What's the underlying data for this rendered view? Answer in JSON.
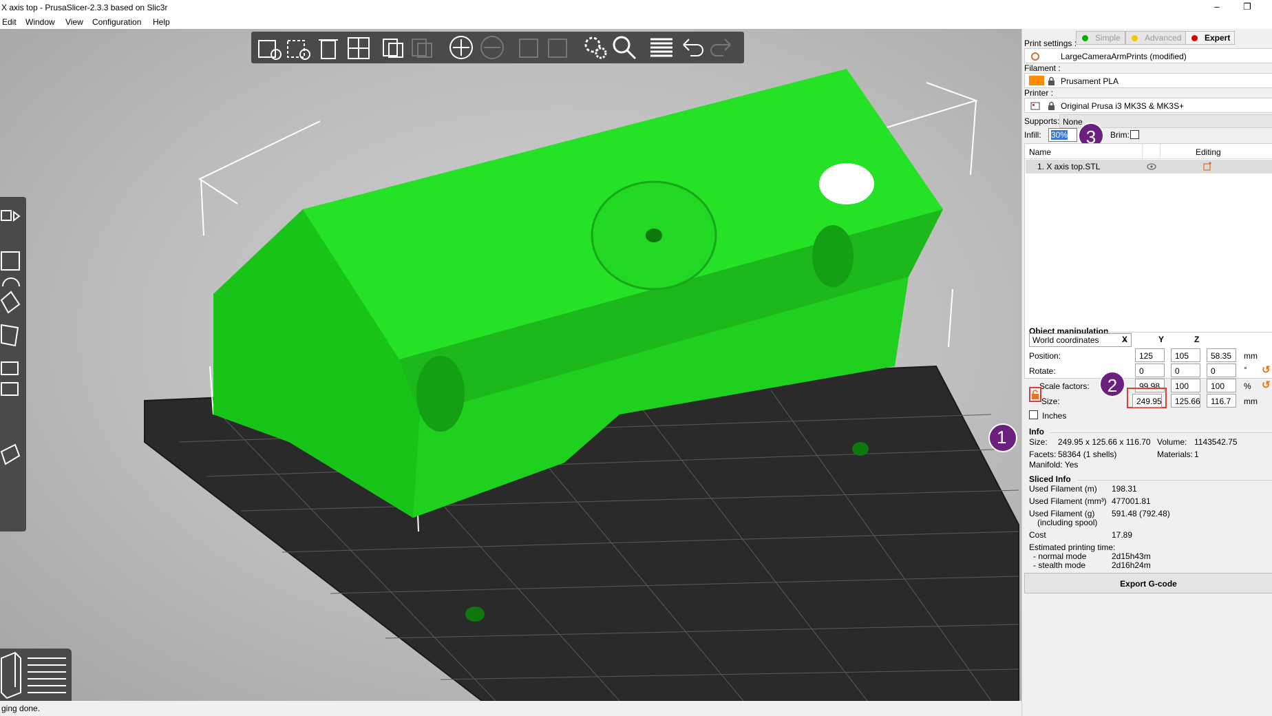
{
  "window": {
    "title": "X axis top - PrusaSlicer-2.3.3 based on Slic3r",
    "minimize": "–",
    "maximize": "❐"
  },
  "menu": [
    "Edit",
    "Window",
    "View",
    "Configuration",
    "Help"
  ],
  "toolbar_icons": [
    "add-icon",
    "delete-icon",
    "delete-all-icon",
    "arrange-icon",
    "copy-icon",
    "paste-icon",
    "add-instance-icon",
    "remove-instance-icon",
    "split-objects-icon",
    "split-parts-icon",
    "variable-layer-height-icon",
    "search-icon",
    "layers-editing-icon",
    "undo-icon",
    "redo-icon"
  ],
  "left_tool_icons": [
    "move-icon",
    "scale-icon",
    "rotate-icon",
    "place-on-face-icon",
    "cut-icon",
    "hollow-icon",
    "support-points-icon",
    "seam-painting-icon"
  ],
  "view_toggle_icons": [
    "3d-view-icon",
    "preview-icon"
  ],
  "status": "ging done.",
  "modes": {
    "simple": "Simple",
    "advanced": "Advanced",
    "expert": "Expert"
  },
  "mode_colors": {
    "simple": "#00b000",
    "advanced": "#f0c800",
    "expert": "#e00000"
  },
  "print_settings": {
    "label": "Print settings :",
    "value": "LargeCameraArmPrints (modified)"
  },
  "filament": {
    "label": "Filament :",
    "value": "Prusament PLA",
    "color": "#ff8c00"
  },
  "printer": {
    "label": "Printer :",
    "value": "Original Prusa i3 MK3S & MK3S+"
  },
  "supports": {
    "label": "Supports:",
    "value": "None"
  },
  "infill": {
    "label": "Infill:",
    "value": "30%"
  },
  "brim": {
    "label": "Brim:",
    "checked": false
  },
  "object_list": {
    "col_name": "Name",
    "col_editing": "Editing",
    "rows": [
      {
        "name": "1. X axis top.STL"
      }
    ]
  },
  "object_manipulation": {
    "title": "Object manipulation",
    "coord_system": "World coordinates",
    "axes": [
      "X",
      "Y",
      "Z"
    ],
    "position": {
      "label": "Position:",
      "x": "125",
      "y": "105",
      "z": "58.35",
      "unit": "mm"
    },
    "rotate": {
      "label": "Rotate:",
      "x": "0",
      "y": "0",
      "z": "0",
      "unit": "°"
    },
    "scale": {
      "label": "Scale factors:",
      "x": "99.98",
      "y": "100",
      "z": "100",
      "unit": "%"
    },
    "size": {
      "label": "Size:",
      "x": "249.95",
      "y": "125.66",
      "z": "116.7",
      "unit": "mm"
    },
    "inches_label": "Inches"
  },
  "info": {
    "title": "Info",
    "size_label": "Size:",
    "size_value": "249.95 x 125.66 x 116.70",
    "volume_label": "Volume:",
    "volume_value": "1143542.75",
    "facets_label": "Facets:",
    "facets_value": "58364 (1 shells)",
    "materials_label": "Materials:",
    "materials_value": "1",
    "manifold": "Manifold: Yes"
  },
  "sliced_info": {
    "title": "Sliced Info",
    "used_filament_m_label": "Used Filament (m)",
    "used_filament_m": "198.31",
    "used_filament_mm3_label": "Used Filament (mm³)",
    "used_filament_mm3": "477001.81",
    "used_filament_g_label": "Used Filament (g)",
    "used_filament_g_sub": "(including spool)",
    "used_filament_g": "591.48 (792.48)",
    "cost_label": "Cost",
    "cost": "17.89",
    "print_time_label": "Estimated printing time:",
    "normal_label": "- normal mode",
    "normal": "2d15h43m",
    "stealth_label": "- stealth mode",
    "stealth": "2d16h24m"
  },
  "export_button": "Export G-code",
  "callouts": [
    "1",
    "2",
    "3"
  ],
  "callout_color": "#6b1f7f"
}
